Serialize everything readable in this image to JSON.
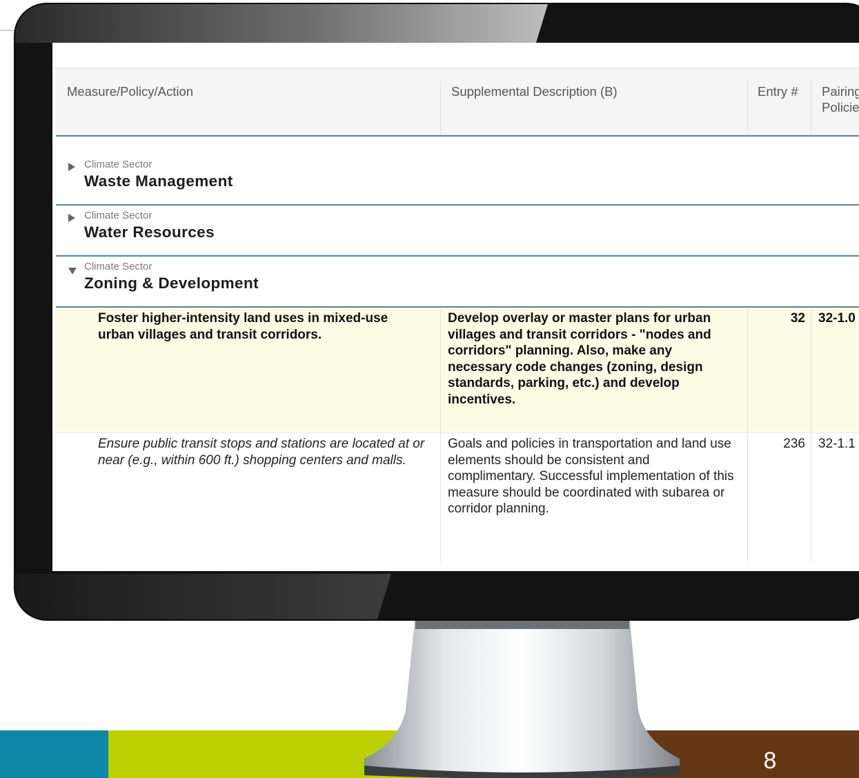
{
  "table": {
    "columns": [
      "Measure/Policy/Action",
      "Supplemental Description (B)",
      "Entry #",
      "Pairing Policies"
    ],
    "sector_caption": "Climate Sector",
    "sectors": [
      {
        "name": "Waste Management",
        "expanded": false
      },
      {
        "name": "Water Resources",
        "expanded": false
      },
      {
        "name": "Zoning & Development",
        "expanded": true
      }
    ],
    "rows": [
      {
        "measure": "Foster higher-intensity land uses in mixed-use urban villages and transit corridors.",
        "description": "Develop overlay or master plans for urban villages and transit corridors - \"nodes and corridors\" planning. Also, make any necessary code changes (zoning, design standards, parking, etc.) and develop incentives.",
        "entry": "32",
        "pairing": "32-1.0",
        "highlighted": true
      },
      {
        "measure": "Ensure public transit stops and stations are located at or near (e.g., within 600 ft.) shopping centers and malls.",
        "description": "Goals and policies in transportation and land use elements should be consistent and complimentary. Successful implementation of this measure should be coordinated with subarea or corridor planning.",
        "entry": "236",
        "pairing": "32-1.1",
        "highlighted": false
      }
    ]
  },
  "footer": {
    "page_number": "8",
    "colors": [
      "#0d86a8",
      "#bccf00",
      "#6a3c18"
    ]
  }
}
